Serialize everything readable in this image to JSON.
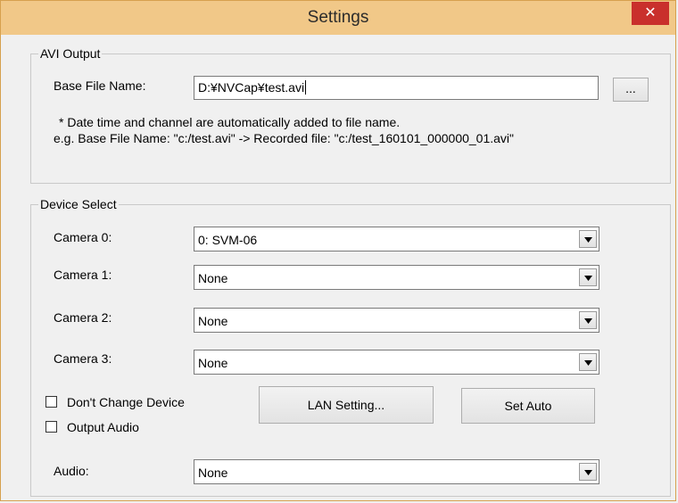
{
  "window": {
    "title": "Settings",
    "close_glyph": "✕"
  },
  "avi_output": {
    "group_label": "AVI Output",
    "base_file_label": "Base File Name:",
    "base_file_value": "D:¥NVCap¥test.avi",
    "browse_label": "...",
    "note_line1": "* Date time and channel are automatically added to file name.",
    "note_line2": "e.g. Base File Name: \"c:/test.avi\" -> Recorded file: \"c:/test_160101_000000_01.avi\""
  },
  "device_select": {
    "group_label": "Device Select",
    "cameras": [
      {
        "label": "Camera 0:",
        "value": "0: SVM-06"
      },
      {
        "label": "Camera 1:",
        "value": "None"
      },
      {
        "label": "Camera 2:",
        "value": "None"
      },
      {
        "label": "Camera 3:",
        "value": "None"
      }
    ],
    "dont_change_label": "Don't Change Device",
    "output_audio_label": "Output Audio",
    "lan_setting_label": "LAN Setting...",
    "set_auto_label": "Set Auto",
    "audio_label": "Audio:",
    "audio_value": "None"
  }
}
